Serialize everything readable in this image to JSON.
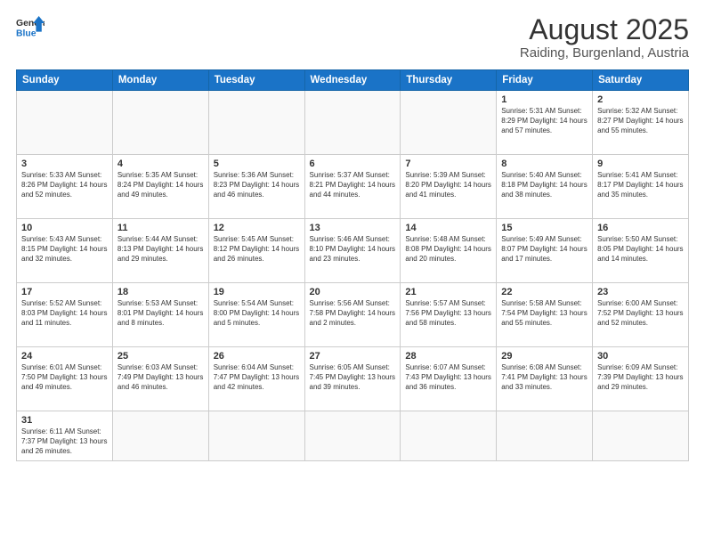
{
  "header": {
    "logo_general": "General",
    "logo_blue": "Blue",
    "title": "August 2025",
    "subtitle": "Raiding, Burgenland, Austria"
  },
  "weekdays": [
    "Sunday",
    "Monday",
    "Tuesday",
    "Wednesday",
    "Thursday",
    "Friday",
    "Saturday"
  ],
  "weeks": [
    [
      {
        "day": "",
        "info": ""
      },
      {
        "day": "",
        "info": ""
      },
      {
        "day": "",
        "info": ""
      },
      {
        "day": "",
        "info": ""
      },
      {
        "day": "",
        "info": ""
      },
      {
        "day": "1",
        "info": "Sunrise: 5:31 AM\nSunset: 8:29 PM\nDaylight: 14 hours and 57 minutes."
      },
      {
        "day": "2",
        "info": "Sunrise: 5:32 AM\nSunset: 8:27 PM\nDaylight: 14 hours and 55 minutes."
      }
    ],
    [
      {
        "day": "3",
        "info": "Sunrise: 5:33 AM\nSunset: 8:26 PM\nDaylight: 14 hours and 52 minutes."
      },
      {
        "day": "4",
        "info": "Sunrise: 5:35 AM\nSunset: 8:24 PM\nDaylight: 14 hours and 49 minutes."
      },
      {
        "day": "5",
        "info": "Sunrise: 5:36 AM\nSunset: 8:23 PM\nDaylight: 14 hours and 46 minutes."
      },
      {
        "day": "6",
        "info": "Sunrise: 5:37 AM\nSunset: 8:21 PM\nDaylight: 14 hours and 44 minutes."
      },
      {
        "day": "7",
        "info": "Sunrise: 5:39 AM\nSunset: 8:20 PM\nDaylight: 14 hours and 41 minutes."
      },
      {
        "day": "8",
        "info": "Sunrise: 5:40 AM\nSunset: 8:18 PM\nDaylight: 14 hours and 38 minutes."
      },
      {
        "day": "9",
        "info": "Sunrise: 5:41 AM\nSunset: 8:17 PM\nDaylight: 14 hours and 35 minutes."
      }
    ],
    [
      {
        "day": "10",
        "info": "Sunrise: 5:43 AM\nSunset: 8:15 PM\nDaylight: 14 hours and 32 minutes."
      },
      {
        "day": "11",
        "info": "Sunrise: 5:44 AM\nSunset: 8:13 PM\nDaylight: 14 hours and 29 minutes."
      },
      {
        "day": "12",
        "info": "Sunrise: 5:45 AM\nSunset: 8:12 PM\nDaylight: 14 hours and 26 minutes."
      },
      {
        "day": "13",
        "info": "Sunrise: 5:46 AM\nSunset: 8:10 PM\nDaylight: 14 hours and 23 minutes."
      },
      {
        "day": "14",
        "info": "Sunrise: 5:48 AM\nSunset: 8:08 PM\nDaylight: 14 hours and 20 minutes."
      },
      {
        "day": "15",
        "info": "Sunrise: 5:49 AM\nSunset: 8:07 PM\nDaylight: 14 hours and 17 minutes."
      },
      {
        "day": "16",
        "info": "Sunrise: 5:50 AM\nSunset: 8:05 PM\nDaylight: 14 hours and 14 minutes."
      }
    ],
    [
      {
        "day": "17",
        "info": "Sunrise: 5:52 AM\nSunset: 8:03 PM\nDaylight: 14 hours and 11 minutes."
      },
      {
        "day": "18",
        "info": "Sunrise: 5:53 AM\nSunset: 8:01 PM\nDaylight: 14 hours and 8 minutes."
      },
      {
        "day": "19",
        "info": "Sunrise: 5:54 AM\nSunset: 8:00 PM\nDaylight: 14 hours and 5 minutes."
      },
      {
        "day": "20",
        "info": "Sunrise: 5:56 AM\nSunset: 7:58 PM\nDaylight: 14 hours and 2 minutes."
      },
      {
        "day": "21",
        "info": "Sunrise: 5:57 AM\nSunset: 7:56 PM\nDaylight: 13 hours and 58 minutes."
      },
      {
        "day": "22",
        "info": "Sunrise: 5:58 AM\nSunset: 7:54 PM\nDaylight: 13 hours and 55 minutes."
      },
      {
        "day": "23",
        "info": "Sunrise: 6:00 AM\nSunset: 7:52 PM\nDaylight: 13 hours and 52 minutes."
      }
    ],
    [
      {
        "day": "24",
        "info": "Sunrise: 6:01 AM\nSunset: 7:50 PM\nDaylight: 13 hours and 49 minutes."
      },
      {
        "day": "25",
        "info": "Sunrise: 6:03 AM\nSunset: 7:49 PM\nDaylight: 13 hours and 46 minutes."
      },
      {
        "day": "26",
        "info": "Sunrise: 6:04 AM\nSunset: 7:47 PM\nDaylight: 13 hours and 42 minutes."
      },
      {
        "day": "27",
        "info": "Sunrise: 6:05 AM\nSunset: 7:45 PM\nDaylight: 13 hours and 39 minutes."
      },
      {
        "day": "28",
        "info": "Sunrise: 6:07 AM\nSunset: 7:43 PM\nDaylight: 13 hours and 36 minutes."
      },
      {
        "day": "29",
        "info": "Sunrise: 6:08 AM\nSunset: 7:41 PM\nDaylight: 13 hours and 33 minutes."
      },
      {
        "day": "30",
        "info": "Sunrise: 6:09 AM\nSunset: 7:39 PM\nDaylight: 13 hours and 29 minutes."
      }
    ],
    [
      {
        "day": "31",
        "info": "Sunrise: 6:11 AM\nSunset: 7:37 PM\nDaylight: 13 hours and 26 minutes."
      },
      {
        "day": "",
        "info": ""
      },
      {
        "day": "",
        "info": ""
      },
      {
        "day": "",
        "info": ""
      },
      {
        "day": "",
        "info": ""
      },
      {
        "day": "",
        "info": ""
      },
      {
        "day": "",
        "info": ""
      }
    ]
  ]
}
